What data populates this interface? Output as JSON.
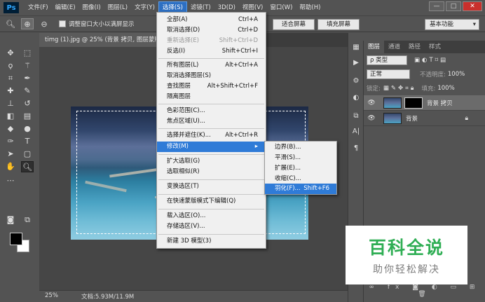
{
  "app": {
    "logo": "Ps"
  },
  "menubar": {
    "items": [
      "文件(F)",
      "编辑(E)",
      "图像(I)",
      "图层(L)",
      "文字(Y)",
      "选择(S)",
      "滤镜(T)",
      "3D(D)",
      "视图(V)",
      "窗口(W)",
      "帮助(H)"
    ],
    "active": "选择(S)"
  },
  "window_controls": {
    "minimize": "—",
    "maximize": "□",
    "close": "✕"
  },
  "options_bar": {
    "resize_label": "调整窗口大小以满屏显示",
    "fit_screen": "适合屏幕",
    "fill_screen": "填充屏幕",
    "workspace": "基本功能"
  },
  "document": {
    "tab_title": "timg (1).jpg @ 25% (背景 拷贝, 图层蒙版/...",
    "zoom": "25%",
    "doc_info": "文档:5.93M/11.9M"
  },
  "select_menu": {
    "items": [
      {
        "label": "全部(A)",
        "shortcut": "Ctrl+A"
      },
      {
        "label": "取消选择(D)",
        "shortcut": "Ctrl+D"
      },
      {
        "label": "重新选择(E)",
        "shortcut": "Shift+Ctrl+D",
        "disabled": true
      },
      {
        "label": "反选(I)",
        "shortcut": "Shift+Ctrl+I"
      },
      {
        "label": "所有图层(L)",
        "shortcut": "Alt+Ctrl+A"
      },
      {
        "label": "取消选择图层(S)",
        "shortcut": ""
      },
      {
        "label": "查找图层",
        "shortcut": "Alt+Shift+Ctrl+F"
      },
      {
        "label": "隔离图层",
        "shortcut": ""
      },
      {
        "label": "色彩范围(C)...",
        "shortcut": ""
      },
      {
        "label": "焦点区域(U)...",
        "shortcut": ""
      },
      {
        "label": "选择并遮住(K)...",
        "shortcut": "Alt+Ctrl+R"
      },
      {
        "label": "修改(M)",
        "shortcut": ""
      },
      {
        "label": "扩大选取(G)",
        "shortcut": ""
      },
      {
        "label": "选取相似(R)",
        "shortcut": ""
      },
      {
        "label": "变换选区(T)",
        "shortcut": ""
      },
      {
        "label": "在快速蒙版模式下编辑(Q)",
        "shortcut": ""
      },
      {
        "label": "载入选区(O)...",
        "shortcut": ""
      },
      {
        "label": "存储选区(V)...",
        "shortcut": ""
      },
      {
        "label": "新建 3D 模型(3)",
        "shortcut": ""
      }
    ]
  },
  "modify_submenu": {
    "items": [
      {
        "label": "边界(B)...",
        "shortcut": ""
      },
      {
        "label": "平滑(S)...",
        "shortcut": ""
      },
      {
        "label": "扩展(E)...",
        "shortcut": ""
      },
      {
        "label": "收缩(C)...",
        "shortcut": ""
      },
      {
        "label": "羽化(F)...",
        "shortcut": "Shift+F6"
      }
    ]
  },
  "layers_panel": {
    "tabs": [
      "图层",
      "通道",
      "路径",
      "样式"
    ],
    "kind_filter": "ρ 类型",
    "blend_mode": "正常",
    "opacity_label": "不透明度:",
    "opacity_value": "100%",
    "lock_label": "锁定:",
    "fill_label": "填充:",
    "fill_value": "100%",
    "layers": [
      {
        "name": "背景 拷贝",
        "selected": true,
        "has_mask": true
      },
      {
        "name": "背景",
        "selected": false,
        "has_mask": false,
        "locked": true
      }
    ]
  },
  "watermark": {
    "title": "百科全说",
    "subtitle": "助你轻松解决"
  }
}
